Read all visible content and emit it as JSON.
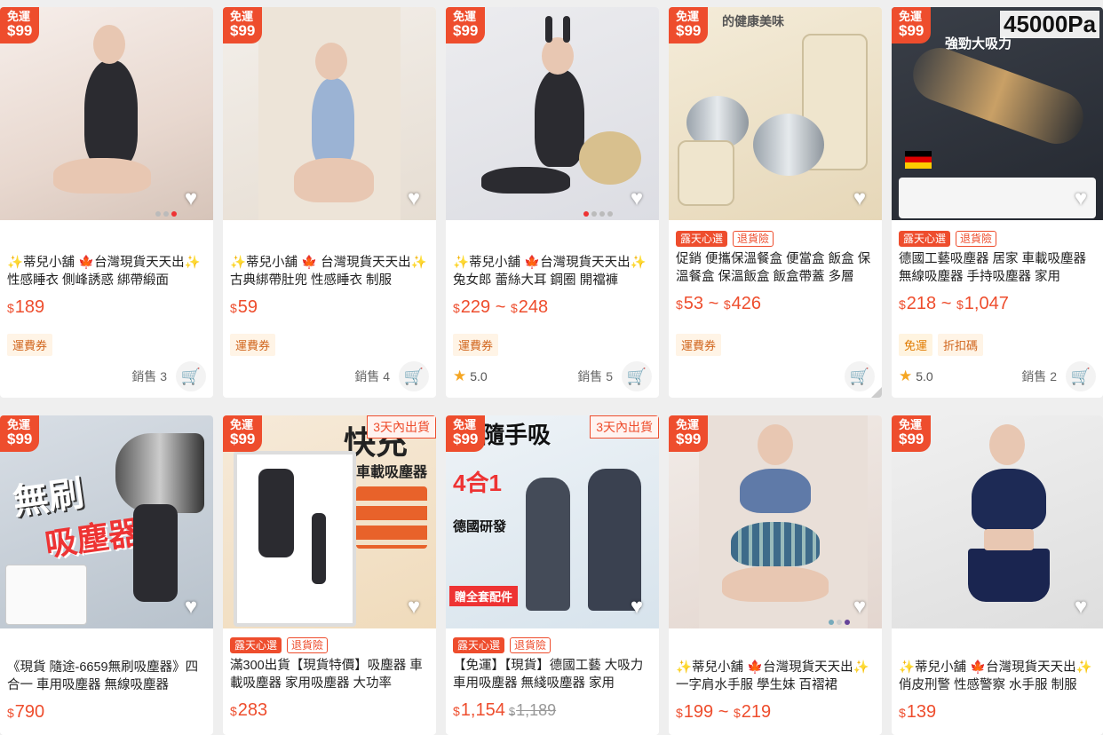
{
  "badge": {
    "line1": "免運",
    "line2": "$99"
  },
  "currency": "$",
  "products": [
    {
      "image_icon": "lingerie-photo",
      "shipping_tag": "",
      "promos": [],
      "title": "✨蒂兒小舖 🍁台灣現貨天天出✨性感睡衣 側峰誘惑 綁帶緞面",
      "price_from": "189",
      "price_to": "",
      "price_old": "",
      "tags": [
        "運費券"
      ],
      "rating": "",
      "sold": "銷售 3"
    },
    {
      "image_icon": "lingerie-photo",
      "shipping_tag": "",
      "promos": [],
      "title": "✨蒂兒小舖 🍁 台灣現貨天天出✨古典綁帶肚兜 性感睡衣 制服",
      "price_from": "59",
      "price_to": "",
      "price_old": "",
      "tags": [
        "運費券"
      ],
      "rating": "",
      "sold": "銷售 4"
    },
    {
      "image_icon": "costume-photo",
      "shipping_tag": "",
      "promos": [],
      "title": "✨蒂兒小舖 🍁台灣現貨天天出✨兔女郎 蕾絲大耳 鋼圈 開襠褲",
      "price_from": "229",
      "price_to": "248",
      "price_old": "",
      "tags": [
        "運費券"
      ],
      "rating": "5.0",
      "sold": "銷售 5"
    },
    {
      "image_icon": "lunchbox-photo",
      "shipping_tag": "",
      "promos": [
        "露天心選",
        "退貨險"
      ],
      "title": "促銷 便攜保溫餐盒 便當盒 飯盒 保溫餐盒 保溫飯盒 飯盒帶蓋 多層",
      "price_from": "53",
      "price_to": "426",
      "price_old": "",
      "tags": [
        "運費券"
      ],
      "rating": "",
      "sold": ""
    },
    {
      "image_icon": "vacuum-photo",
      "shipping_tag": "",
      "promos": [
        "露天心選",
        "退貨險"
      ],
      "title": "德國工藝吸塵器 居家 車載吸塵器 無線吸塵器 手持吸塵器 家用",
      "price_from": "218",
      "price_to": "1,047",
      "price_old": "",
      "tags": [
        "免運",
        "折扣碼"
      ],
      "rating": "5.0",
      "sold": "銷售 2"
    },
    {
      "image_icon": "vacuum-photo",
      "shipping_tag": "",
      "promos": [],
      "title": "《現貨 隨途-6659無刷吸塵器》四合一 車用吸塵器 無線吸塵器",
      "price_from": "790",
      "price_to": "",
      "price_old": "",
      "tags": [],
      "rating": "",
      "sold": ""
    },
    {
      "image_icon": "vacuum-photo",
      "shipping_tag": "3天內出貨",
      "promos": [
        "露天心選",
        "退貨險"
      ],
      "title": "滿300出貨【現貨特價】吸塵器 車載吸塵器 家用吸塵器 大功率",
      "price_from": "283",
      "price_to": "",
      "price_old": "",
      "tags": [],
      "rating": "",
      "sold": ""
    },
    {
      "image_icon": "vacuum-photo",
      "shipping_tag": "3天內出貨",
      "promos": [
        "露天心選",
        "退貨險"
      ],
      "title": "【免運】【現貨】德國工藝 大吸力車用吸塵器 無綫吸塵器 家用",
      "price_from": "1,154",
      "price_to": "",
      "price_old": "1,189",
      "tags": [],
      "rating": "",
      "sold": ""
    },
    {
      "image_icon": "uniform-photo",
      "shipping_tag": "",
      "promos": [],
      "title": "✨蒂兒小舖 🍁台灣現貨天天出✨一字肩水手服 學生妹 百褶裙",
      "price_from": "199",
      "price_to": "219",
      "price_old": "",
      "tags": [],
      "rating": "",
      "sold": ""
    },
    {
      "image_icon": "uniform-photo",
      "shipping_tag": "",
      "promos": [],
      "title": "✨蒂兒小舖 🍁台灣現貨天天出✨俏皮刑警 性感警察 水手服 制服",
      "price_from": "139",
      "price_to": "",
      "price_old": "",
      "tags": [],
      "rating": "",
      "sold": ""
    }
  ],
  "image_text": {
    "p5_top": "45000Pa",
    "p5_sub": "強勁大吸力",
    "p6_main": "無刷",
    "p6_sub": "吸塵器",
    "p7_main": "快充",
    "p7_sub": "車載吸塵器",
    "p8_main": "隨手吸",
    "p8_sub": "4合1",
    "p8_sub2": "德國研發",
    "p8_sub3": "贈全套配件",
    "p4_sub": "的健康美味"
  },
  "colors": {
    "accent": "#ee4d2d",
    "tag_bg": "#fff4e6",
    "star": "#f5a623"
  }
}
